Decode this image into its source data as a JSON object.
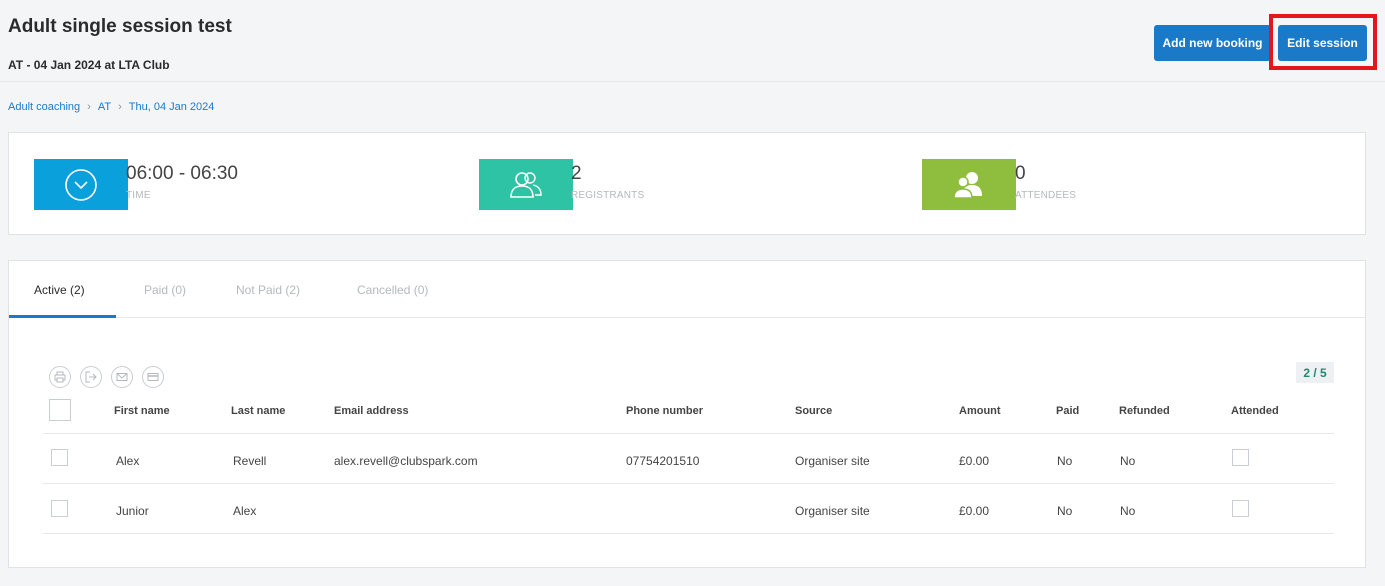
{
  "header": {
    "title": "Adult single session test",
    "subtitle": "AT - 04 Jan 2024 at LTA Club",
    "add_booking_label": "Add new booking",
    "edit_session_label": "Edit session"
  },
  "breadcrumb": {
    "items": [
      "Adult coaching",
      "AT",
      "Thu, 04 Jan 2024"
    ],
    "separator": "›"
  },
  "stats": {
    "time": {
      "value": "06:00 - 06:30",
      "label": "TIME",
      "icon": "clock-icon",
      "color": "#0aa0dc"
    },
    "registrants": {
      "value": "2",
      "label": "REGISTRANTS",
      "icon": "users-icon",
      "color": "#2ec3a5"
    },
    "attendees": {
      "value": "0",
      "label": "ATTENDEES",
      "icon": "attendees-icon",
      "color": "#8fbe3f"
    }
  },
  "tabs": [
    {
      "label": "Active (2)",
      "active": true
    },
    {
      "label": "Paid (0)",
      "active": false
    },
    {
      "label": "Not Paid (2)",
      "active": false
    },
    {
      "label": "Cancelled (0)",
      "active": false
    }
  ],
  "toolbar": {
    "icons": [
      "print-icon",
      "export-icon",
      "email-icon",
      "card-icon"
    ],
    "page_count": "2 / 5"
  },
  "table": {
    "columns": [
      "First name",
      "Last name",
      "Email address",
      "Phone number",
      "Source",
      "Amount",
      "Paid",
      "Refunded",
      "Attended"
    ],
    "rows": [
      {
        "first": "Alex",
        "last": "Revell",
        "email": "alex.revell@clubspark.com",
        "phone": "07754201510",
        "source": "Organiser site",
        "amount": "£0.00",
        "paid": "No",
        "refunded": "No"
      },
      {
        "first": "Junior",
        "last": "Alex",
        "email": "",
        "phone": "",
        "source": "Organiser site",
        "amount": "£0.00",
        "paid": "No",
        "refunded": "No"
      }
    ]
  },
  "colors": {
    "primary": "#1a7ac8",
    "highlight": "#e3161b"
  }
}
